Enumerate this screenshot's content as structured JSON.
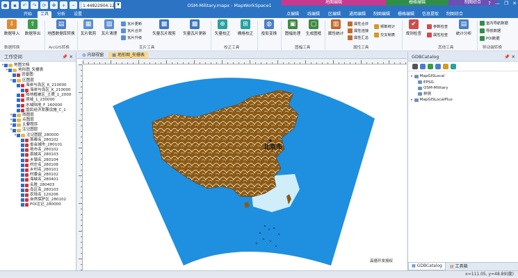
{
  "titlebar": {
    "doc_select": "1:44822904.12...",
    "title": "OSM-Military.mapx - MapWorkSpace1",
    "context_groups": [
      "地图编辑",
      "栅格编辑",
      "制图综合"
    ],
    "window_buttons": [
      "?",
      "—",
      "❐",
      "✕"
    ]
  },
  "tabs": [
    {
      "label": "开始",
      "active": false
    },
    {
      "label": "工具",
      "active": true
    },
    {
      "label": "分析",
      "active": false
    },
    {
      "label": "设置",
      "active": false
    },
    {
      "label": "点编辑",
      "active": false
    },
    {
      "label": "线编辑",
      "active": false
    },
    {
      "label": "区编辑",
      "active": false
    },
    {
      "label": "通用编辑",
      "active": false
    },
    {
      "label": "制图编辑",
      "active": false
    },
    {
      "label": "栅格编辑",
      "active": false
    },
    {
      "label": "信息提取",
      "active": false
    },
    {
      "label": "制图综合",
      "active": false
    }
  ],
  "ribbon": {
    "groups": {
      "data_convert": "数据转换",
      "arcgis_convert": "ArcGIS转换",
      "tile_tools": "瓦片工具",
      "correction_tools": "校正工具",
      "frame_tools": "图幅工具",
      "attribute_tools": "属性工具",
      "other_tools": "其他工具",
      "mobile_convert": "移动端转换"
    },
    "buttons": {
      "data_import": "数据导入",
      "data_export": "数据导出",
      "arcgis_batch": "地图数据库转换",
      "tile_crop": "瓦片裁剪",
      "tile_clean": "瓦片清理",
      "tile_update": "瓦片更新",
      "tile_merge": "瓦片合并",
      "tile_upgrade": "瓦片升级",
      "vector_tile_crop": "矢量瓦片裁剪",
      "vector_tile_update": "矢量瓦片更新",
      "vector_correct": "矢量校正",
      "raster_correct": "栅格校正",
      "projection": "投影变换",
      "frame_process": "图幅处理",
      "make_frame": "生成图框",
      "attr_stats": "属性统计",
      "attr_merge": "属性合并",
      "attr_connect": "属性连接",
      "attr_summary": "属性汇总",
      "freq_stats": "频数统计",
      "cross_table": "交叉制表",
      "topo_check": "规则检查",
      "param_check": "参数检查",
      "attr_check": "属性检查",
      "stats_analysis": "统计分析",
      "customize": "定制检查",
      "indoor_nav": "室内导航数据",
      "nav_data": "导航数据",
      "poi_data": "POI数据"
    }
  },
  "workspace": {
    "title": "工作空间",
    "pin": "📌 ✕",
    "tree": [
      {
        "label": "地图文档",
        "level": 0,
        "type": "root"
      },
      {
        "label": "地形图_矢栅表",
        "level": 1,
        "type": "map"
      },
      {
        "label": "背景图",
        "level": 2,
        "type": "layer"
      },
      {
        "label": "区图层",
        "level": 2,
        "type": "folder"
      },
      {
        "label": "海岸与岛区_K_210000",
        "level": 3,
        "type": "layer"
      },
      {
        "label": "海岸与岛区_K_210000",
        "level": 4,
        "type": "layer"
      },
      {
        "label": "陆地植被区_土质_1_2000",
        "level": 3,
        "type": "layer"
      },
      {
        "label": "境域_1_230000",
        "level": 3,
        "type": "layer"
      },
      {
        "label": "水域陆地_F_160000",
        "level": 3,
        "type": "layer"
      },
      {
        "label": "国民经济发展设施_C_1",
        "level": 3,
        "type": "layer"
      },
      {
        "label": "线图层",
        "level": 2,
        "type": "folder"
      },
      {
        "label": "点图层",
        "level": 2,
        "type": "folder"
      },
      {
        "label": "主要程序",
        "level": 2,
        "type": "folder"
      },
      {
        "label": "注记图层",
        "level": 2,
        "type": "folder"
      },
      {
        "label": "注记图层_280000",
        "level": 3,
        "type": "folder"
      },
      {
        "label": "首都名_280102",
        "level": 4,
        "type": "layer"
      },
      {
        "label": "省会城市_280101",
        "level": 4,
        "type": "layer"
      },
      {
        "label": "地市名_280102",
        "level": 4,
        "type": "layer"
      },
      {
        "label": "县城名_280103",
        "level": 4,
        "type": "layer"
      },
      {
        "label": "乡镇名_280104",
        "level": 4,
        "type": "layer"
      },
      {
        "label": "村庄名_280106",
        "level": 4,
        "type": "layer"
      },
      {
        "label": "乡村名_280101",
        "level": 4,
        "type": "layer"
      },
      {
        "label": "村委会_280102",
        "level": 4,
        "type": "layer"
      },
      {
        "label": "海峡名_280401",
        "level": 4,
        "type": "layer"
      },
      {
        "label": "名胜_280403",
        "level": 4,
        "type": "layer"
      },
      {
        "label": "岛区名_280103",
        "level": 4,
        "type": "layer"
      },
      {
        "label": "农场名_120206",
        "level": 4,
        "type": "layer"
      },
      {
        "label": "自然保护区_280102",
        "level": 4,
        "type": "layer"
      },
      {
        "label": "POI注记_280000",
        "level": 4,
        "type": "layer"
      }
    ]
  },
  "document_tabs": [
    {
      "label": "内部视窗",
      "active": false
    },
    {
      "label": "地形图_矢栅表",
      "active": true
    }
  ],
  "map": {
    "city_label": "北京市",
    "source_label": "高德开发授权"
  },
  "gdb": {
    "title": "GDBCatalog",
    "pin": "📌 ✕",
    "tree": [
      {
        "label": "MapGISLocal",
        "level": 0
      },
      {
        "label": "EPSG",
        "level": 1
      },
      {
        "label": "OSM-Military",
        "level": 1
      },
      {
        "label": "样例",
        "level": 1
      },
      {
        "label": "MapGISLocalPlus",
        "level": 0
      }
    ],
    "bottom_tabs": [
      {
        "label": "GDBCatalog",
        "active": true
      },
      {
        "label": "工具箱",
        "active": false
      }
    ]
  },
  "status": {
    "coords": "x=111.05, y=48.89(度)"
  },
  "colors": {
    "title_blue": "#2d73c4",
    "ocean": "#1f8fe0",
    "land_brown": "#8b5a16",
    "land_light": "#cfeefa"
  }
}
